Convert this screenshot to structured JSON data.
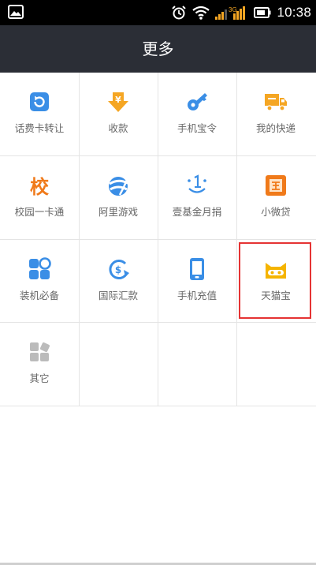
{
  "status_bar": {
    "time": "10:38",
    "network_label": "3G",
    "icons": [
      "gallery-icon",
      "alarm-icon",
      "wifi-icon",
      "signal-icon",
      "battery-icon"
    ]
  },
  "header": {
    "title": "更多"
  },
  "grid": {
    "items": [
      {
        "label": "话费卡转让",
        "icon": "phonecard-transfer-icon",
        "color": "#3a8ee6"
      },
      {
        "label": "收款",
        "icon": "receive-money-icon",
        "color": "#f5a623"
      },
      {
        "label": "手机宝令",
        "icon": "key-icon",
        "color": "#3a8ee6"
      },
      {
        "label": "我的快递",
        "icon": "truck-icon",
        "color": "#f5a623"
      },
      {
        "label": "校园一卡通",
        "icon": "campus-card-icon",
        "icon_text": "校",
        "color": "#f07a1a"
      },
      {
        "label": "阿里游戏",
        "icon": "game-ball-icon",
        "color": "#3a8ee6"
      },
      {
        "label": "壹基金月捐",
        "icon": "one-foundation-icon",
        "color": "#3a8ee6"
      },
      {
        "label": "小微贷",
        "icon": "microloan-icon",
        "color": "#f07a1a"
      },
      {
        "label": "装机必备",
        "icon": "apps-icon",
        "color": "#3a8ee6"
      },
      {
        "label": "国际汇款",
        "icon": "intl-remit-icon",
        "color": "#3a8ee6"
      },
      {
        "label": "手机充值",
        "icon": "mobile-recharge-icon",
        "color": "#3a8ee6"
      },
      {
        "label": "天猫宝",
        "icon": "tmall-cat-icon",
        "color": "#f5b400"
      },
      {
        "label": "其它",
        "icon": "other-icon",
        "color": "#bbbbbb"
      }
    ]
  }
}
